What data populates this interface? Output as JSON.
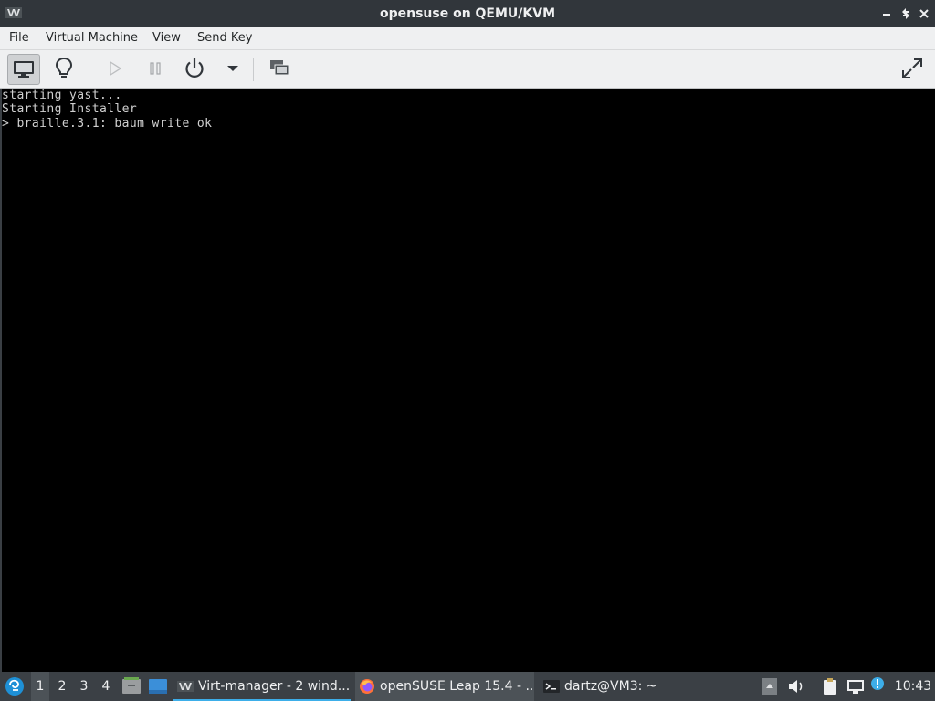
{
  "window": {
    "title": "opensuse on QEMU/KVM"
  },
  "menu": {
    "items": [
      "File",
      "Virtual Machine",
      "View",
      "Send Key"
    ]
  },
  "toolbar": {
    "buttons": [
      {
        "name": "console-view",
        "icon": "monitor-icon",
        "active": true
      },
      {
        "name": "details-view",
        "icon": "lightbulb-icon"
      },
      {
        "name": "run",
        "icon": "play-icon",
        "disabled": true
      },
      {
        "name": "pause",
        "icon": "pause-icon",
        "disabled": true
      },
      {
        "name": "shutdown",
        "icon": "power-icon"
      },
      {
        "name": "shutdown-menu",
        "icon": "chevron-down-icon"
      },
      {
        "name": "screenshot",
        "icon": "screenshot-icon"
      },
      {
        "name": "fullscreen",
        "icon": "fullscreen-icon"
      }
    ]
  },
  "console": {
    "lines": [
      "starting yast...",
      "Starting Installer",
      "> braille.3.1: baum write ok"
    ],
    "text_color": "#d0d0d0",
    "background": "#000000"
  },
  "taskbar": {
    "workspaces": [
      "1",
      "2",
      "3",
      "4"
    ],
    "active_workspace": "1",
    "tasks": [
      {
        "label": "Virt-manager - 2 wind...",
        "icon": "virt-manager-icon"
      },
      {
        "label": "openSUSE Leap 15.4 - ...",
        "icon": "firefox-icon"
      },
      {
        "label": "dartz@VM3: ~",
        "icon": "terminal-icon"
      }
    ],
    "clock": "10:43"
  },
  "colors": {
    "titlebar": "#31363b",
    "menubar": "#eff0f1",
    "taskbar": "#3b4045",
    "accent": "#3daee9"
  }
}
